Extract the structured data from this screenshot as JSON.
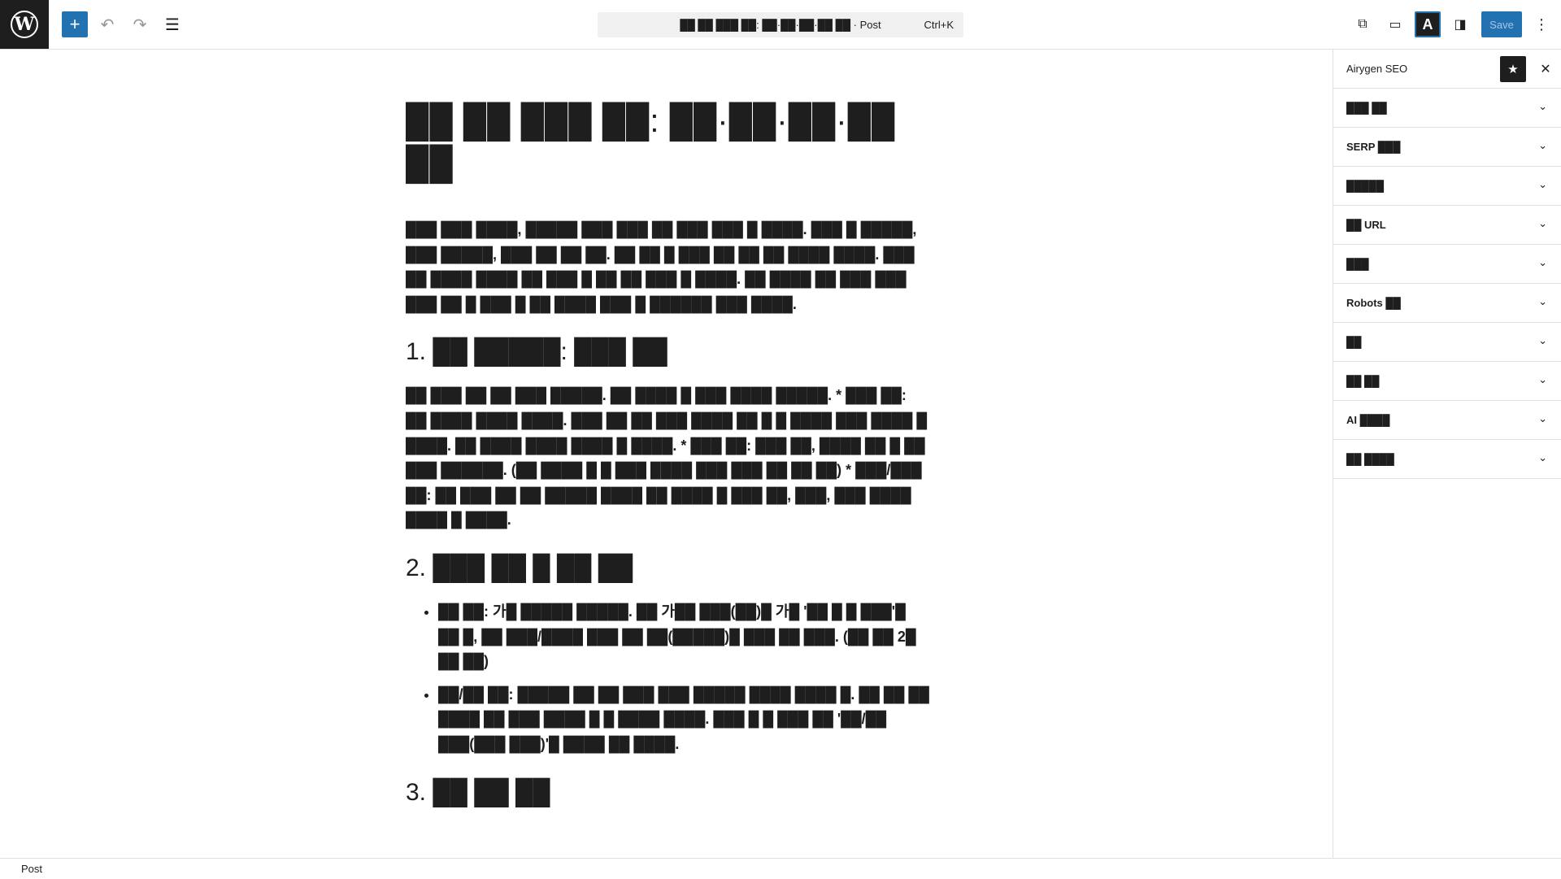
{
  "topbar": {
    "add_label": "+",
    "undo_label": "↶",
    "redo_label": "↷",
    "list_view_label": "☰",
    "command_title": "██ ██ ███ ██: ██·██·██·██ ██ · Post",
    "command_shortcut": "Ctrl+K",
    "view_label": "⧉",
    "device_label": "▭",
    "airygen_label": "A",
    "sidebar_toggle_label": "◨",
    "save_label": "Save",
    "more_label": "⋮"
  },
  "post": {
    "title": "██ ██ ███ ██: ██·██·██·██ ██",
    "intro": "███ ███ ████, █████ ███ ███ ██ ███ ███ █ ████. ███ █ █████, ███ █████, ███ ██ ██ ██. ██ ██ █ ███ ██ ██ ██ ████ ████. ███ ██ ████ ████ ██ ███ █ ██ ██ ███ █ ████. ██ ████ ██ ███ ███ ███ ██ █ ███ █ ██ ████ ███ █ ██████ ███ ████.",
    "h1": "1. ██ █████: ███ ██",
    "p1": "██ ███ ██ ██ ███ █████. ██ ████ █ ███ ████ █████. * ███ ██: ██ ████ ████ ████. ███ ██ ██ ███ ████ ██ █ █ ████ ███ ████ █ ████. ██ ████ ████ ████ █ ████. * ███ ██: ███ ██, ████ ██ █ ██ ███ ██████. (██ ████ █ █ ███ ████ ███ ███ ██ ██ ██) * ███/███ ██: ██ ███ ██ ██ █████ ████ ██ ████ █ ███ ██, ███, ███ ████ ████ █ ████.",
    "h2": "2. ███ ██ █ ██ ██",
    "list": [
      "██ ██: 가█ █████ █████. ██ 가██ ███(██)█ 가█ '██ █ █ ███'█ ██ █, ██ ███/████ ███ ██ ██(█████)█ ███ ██ ███. (██ ██ 2█ ██ ██)",
      "██/██ ██: █████ ██ ██ ███ ███ █████ ████ ████ █. ██ ██ ██ ████ ██ ███ ████ █ █ ████ ████. ███ █ █ ███ ██ '██/██ ███(███ ███)'█ ████ ██ ████."
    ],
    "h3": "3. ██ ██ ██"
  },
  "sidebar": {
    "title": "Airygen SEO",
    "star_label": "★",
    "close_label": "✕",
    "chevron": "⌄",
    "panels": [
      "███ ██",
      "SERP ███",
      "█████",
      "██ URL",
      "███",
      "Robots ██",
      "██",
      "██ ██",
      "AI ████",
      "██ ████"
    ]
  },
  "footer": {
    "breadcrumb": "Post"
  }
}
